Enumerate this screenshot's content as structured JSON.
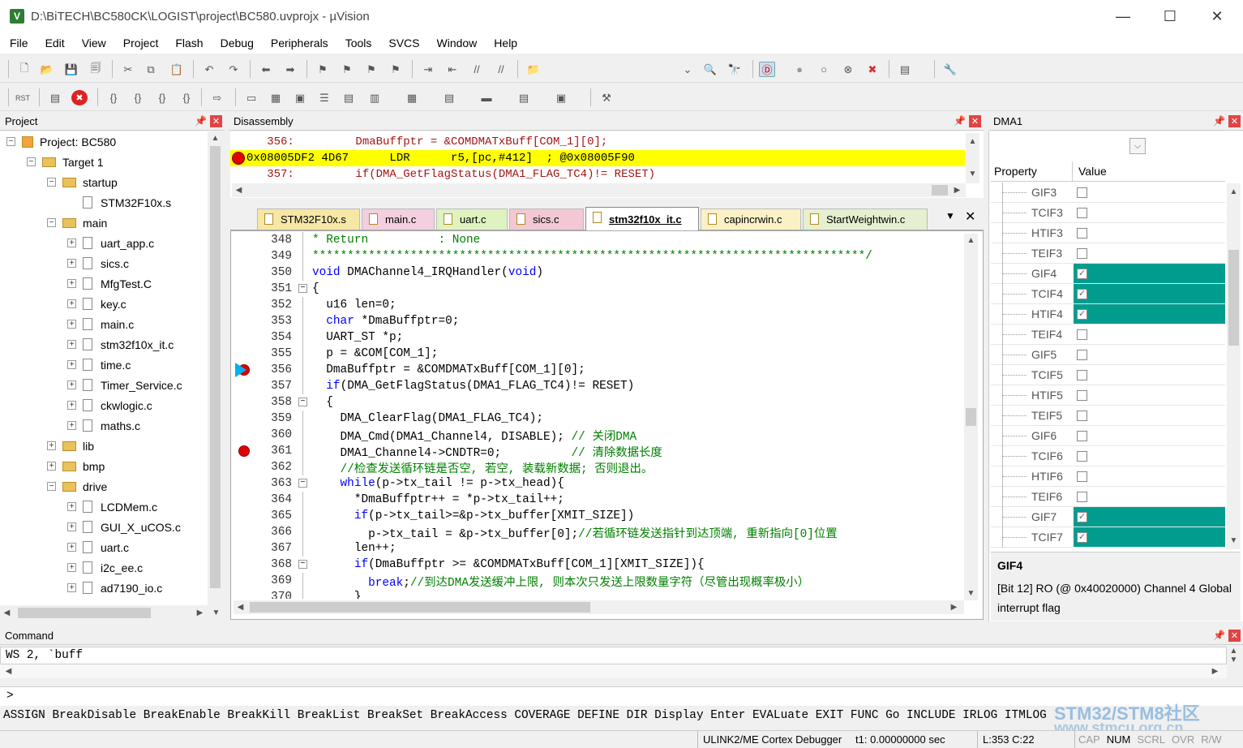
{
  "window": {
    "title": "D:\\BiTECH\\BC580CK\\LOGIST\\project\\BC580.uvprojx - µVision",
    "minimize": "—",
    "maximize": "☐",
    "close": "✕"
  },
  "menu": [
    "File",
    "Edit",
    "View",
    "Project",
    "Flash",
    "Debug",
    "Peripherals",
    "Tools",
    "SVCS",
    "Window",
    "Help"
  ],
  "project_panel": {
    "title": "Project",
    "tree": [
      {
        "label": "Project: BC580",
        "level": 0,
        "type": "project",
        "expander": "−"
      },
      {
        "label": "Target 1",
        "level": 1,
        "type": "target",
        "expander": "−"
      },
      {
        "label": "startup",
        "level": 2,
        "type": "folder",
        "expander": "−"
      },
      {
        "label": "STM32F10x.s",
        "level": 3,
        "type": "file",
        "expander": ""
      },
      {
        "label": "main",
        "level": 2,
        "type": "folder",
        "expander": "−"
      },
      {
        "label": "uart_app.c",
        "level": 3,
        "type": "file",
        "expander": "+"
      },
      {
        "label": "sics.c",
        "level": 3,
        "type": "file",
        "expander": "+"
      },
      {
        "label": "MfgTest.C",
        "level": 3,
        "type": "file",
        "expander": "+"
      },
      {
        "label": "key.c",
        "level": 3,
        "type": "file",
        "expander": "+"
      },
      {
        "label": "main.c",
        "level": 3,
        "type": "file",
        "expander": "+"
      },
      {
        "label": "stm32f10x_it.c",
        "level": 3,
        "type": "file",
        "expander": "+"
      },
      {
        "label": "time.c",
        "level": 3,
        "type": "file",
        "expander": "+"
      },
      {
        "label": "Timer_Service.c",
        "level": 3,
        "type": "file",
        "expander": "+"
      },
      {
        "label": "ckwlogic.c",
        "level": 3,
        "type": "file",
        "expander": "+"
      },
      {
        "label": "maths.c",
        "level": 3,
        "type": "file",
        "expander": "+"
      },
      {
        "label": "lib",
        "level": 2,
        "type": "folder",
        "expander": "+"
      },
      {
        "label": "bmp",
        "level": 2,
        "type": "folder",
        "expander": "+"
      },
      {
        "label": "drive",
        "level": 2,
        "type": "folder",
        "expander": "−"
      },
      {
        "label": "LCDMem.c",
        "level": 3,
        "type": "file",
        "expander": "+"
      },
      {
        "label": "GUI_X_uCOS.c",
        "level": 3,
        "type": "file",
        "expander": "+"
      },
      {
        "label": "uart.c",
        "level": 3,
        "type": "file",
        "expander": "+"
      },
      {
        "label": "i2c_ee.c",
        "level": 3,
        "type": "file",
        "expander": "+"
      },
      {
        "label": "ad7190_io.c",
        "level": 3,
        "type": "file",
        "expander": "+"
      }
    ]
  },
  "disassembly": {
    "title": "Disassembly",
    "lines": [
      {
        "text": "   356:         DmaBuffptr = &COMDMATxBuff[COM_1][0];",
        "highlight": false,
        "bp": false,
        "color": "#a31515"
      },
      {
        "text": "0x08005DF2 4D67      LDR      r5,[pc,#412]  ; @0x08005F90",
        "highlight": true,
        "bp": true,
        "color": "#000000"
      },
      {
        "text": "   357:         if(DMA_GetFlagStatus(DMA1_FLAG_TC4)!= RESET)",
        "highlight": false,
        "bp": false,
        "color": "#a31515"
      }
    ]
  },
  "tabs": [
    {
      "label": "STM32F10x.s",
      "active": false,
      "color": "#f7e7a6"
    },
    {
      "label": "main.c",
      "active": false,
      "color": "#f3cfe0"
    },
    {
      "label": "uart.c",
      "active": false,
      "color": "#dff3c0"
    },
    {
      "label": "sics.c",
      "active": false,
      "color": "#f2c8d4"
    },
    {
      "label": "stm32f10x_it.c",
      "active": true,
      "color": "#ffffff"
    },
    {
      "label": "capincrwin.c",
      "active": false,
      "color": "#fbf1c6"
    },
    {
      "label": "StartWeightwin.c",
      "active": false,
      "color": "#e4f0cf"
    }
  ],
  "editor": {
    "lines": [
      {
        "n": "348",
        "html": "<span class='cm'>* Return          : None</span>"
      },
      {
        "n": "349",
        "html": "<span class='cm'>*******************************************************************************/</span>"
      },
      {
        "n": "350",
        "html": "<span class='kw'>void</span> DMAChannel4_IRQHandler(<span class='kw'>void</span>)"
      },
      {
        "n": "351",
        "html": "{",
        "fold": true
      },
      {
        "n": "352",
        "html": "  u16 len=0;"
      },
      {
        "n": "353",
        "html": "  <span class='kw'>char</span> *DmaBuffptr=0;"
      },
      {
        "n": "354",
        "html": "  UART_ST *p;"
      },
      {
        "n": "355",
        "html": "  p = &amp;COM[COM_1];"
      },
      {
        "n": "356",
        "html": "  DmaBuffptr = &amp;COMDMATxBuff[COM_1][0];",
        "marker": "pc"
      },
      {
        "n": "357",
        "html": "  <span class='kw'>if</span>(DMA_GetFlagStatus(DMA1_FLAG_TC4)!= RESET)"
      },
      {
        "n": "358",
        "html": "  {",
        "fold": true
      },
      {
        "n": "359",
        "html": "    DMA_ClearFlag(DMA1_FLAG_TC4);"
      },
      {
        "n": "360",
        "html": "    DMA_Cmd(DMA1_Channel4, DISABLE); <span class='cm'>// 关闭DMA</span>"
      },
      {
        "n": "361",
        "html": "    DMA1_Channel4-&gt;CNDTR=0;          <span class='cm'>// 清除数据长度</span>",
        "marker": "bp"
      },
      {
        "n": "362",
        "html": "    <span class='cm'>//检查发送循环链是否空, 若空, 装载新数据; 否则退出。</span>"
      },
      {
        "n": "363",
        "html": "    <span class='kw'>while</span>(p-&gt;tx_tail != p-&gt;tx_head){",
        "fold": true
      },
      {
        "n": "364",
        "html": "      *DmaBuffptr++ = *p-&gt;tx_tail++;"
      },
      {
        "n": "365",
        "html": "      <span class='kw'>if</span>(p-&gt;tx_tail&gt;=&amp;p-&gt;tx_buffer[XMIT_SIZE])"
      },
      {
        "n": "366",
        "html": "        p-&gt;tx_tail = &amp;p-&gt;tx_buffer[0];<span class='cm'>//若循环链发送指针到达顶端, 重新指向[0]位置</span>"
      },
      {
        "n": "367",
        "html": "      len++;"
      },
      {
        "n": "368",
        "html": "      <span class='kw'>if</span>(DmaBuffptr &gt;= &amp;COMDMATxBuff[COM_1][XMIT_SIZE]){",
        "fold": true
      },
      {
        "n": "369",
        "html": "        <span class='kw'>break</span>;<span class='cm'>//到达DMA发送缓冲上限, 则本次只发送上限数量字符（尽管出现概率极小）</span>"
      },
      {
        "n": "370",
        "html": "      }"
      }
    ]
  },
  "dma_panel": {
    "title": "DMA1",
    "col_property": "Property",
    "col_value": "Value",
    "rows": [
      {
        "name": "GIF3",
        "checked": false,
        "highlight": false
      },
      {
        "name": "TCIF3",
        "checked": false,
        "highlight": false
      },
      {
        "name": "HTIF3",
        "checked": false,
        "highlight": false
      },
      {
        "name": "TEIF3",
        "checked": false,
        "highlight": false
      },
      {
        "name": "GIF4",
        "checked": true,
        "highlight": true
      },
      {
        "name": "TCIF4",
        "checked": true,
        "highlight": true
      },
      {
        "name": "HTIF4",
        "checked": true,
        "highlight": true
      },
      {
        "name": "TEIF4",
        "checked": false,
        "highlight": false
      },
      {
        "name": "GIF5",
        "checked": false,
        "highlight": false
      },
      {
        "name": "TCIF5",
        "checked": false,
        "highlight": false
      },
      {
        "name": "HTIF5",
        "checked": false,
        "highlight": false
      },
      {
        "name": "TEIF5",
        "checked": false,
        "highlight": false
      },
      {
        "name": "GIF6",
        "checked": false,
        "highlight": false
      },
      {
        "name": "TCIF6",
        "checked": false,
        "highlight": false
      },
      {
        "name": "HTIF6",
        "checked": false,
        "highlight": false
      },
      {
        "name": "TEIF6",
        "checked": false,
        "highlight": false
      },
      {
        "name": "GIF7",
        "checked": true,
        "highlight": true
      },
      {
        "name": "TCIF7",
        "checked": true,
        "highlight": true
      }
    ],
    "highlight_color": "#009d8f",
    "desc_title": "GIF4",
    "desc_text": "[Bit 12] RO (@ 0x40020000) Channel 4 Global interrupt flag"
  },
  "command": {
    "title": "Command",
    "output": "WS 2, `buff",
    "prompt": ">",
    "commands": "ASSIGN BreakDisable BreakEnable BreakKill BreakList BreakSet BreakAccess COVERAGE DEFINE DIR Display Enter EVALuate EXIT FUNC Go INCLUDE IRLOG ITMLOG"
  },
  "statusbar": {
    "debugger": "ULINK2/ME Cortex Debugger",
    "time": "t1: 0.00000000 sec",
    "position": "L:353 C:22",
    "indicators": [
      "CAP",
      "NUM",
      "SCRL",
      "OVR",
      "R/W"
    ]
  },
  "watermark": {
    "line1": "STM32/STM8社区",
    "line2": "www.stmcu.org.cn"
  }
}
